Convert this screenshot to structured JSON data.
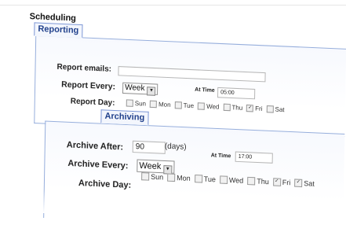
{
  "scheduling": {
    "title": "Scheduling"
  },
  "reporting": {
    "tab_label": "Reporting",
    "emails_label": "Report emails:",
    "emails_value": "",
    "every_label": "Report Every:",
    "every_value": "Week",
    "at_time_label": "At Time",
    "at_time_value": "05:00",
    "day_label": "Report Day:",
    "days": [
      {
        "label": "Sun",
        "checked": false
      },
      {
        "label": "Mon",
        "checked": false
      },
      {
        "label": "Tue",
        "checked": false
      },
      {
        "label": "Wed",
        "checked": false
      },
      {
        "label": "Thu",
        "checked": false
      },
      {
        "label": "Fri",
        "checked": true
      },
      {
        "label": "Sat",
        "checked": false
      }
    ]
  },
  "archiving": {
    "tab_label": "Archiving",
    "after_label": "Archive After:",
    "after_value": "90",
    "after_unit": "(days)",
    "every_label": "Archive Every:",
    "every_value": "Week",
    "at_time_label": "At Time",
    "at_time_value": "17:00",
    "day_label": "Archive Day:",
    "days": [
      {
        "label": "Sun",
        "checked": false
      },
      {
        "label": "Mon",
        "checked": false
      },
      {
        "label": "Tue",
        "checked": false
      },
      {
        "label": "Wed",
        "checked": false
      },
      {
        "label": "Thu",
        "checked": false
      },
      {
        "label": "Fri",
        "checked": true
      },
      {
        "label": "Sat",
        "checked": true
      }
    ]
  }
}
